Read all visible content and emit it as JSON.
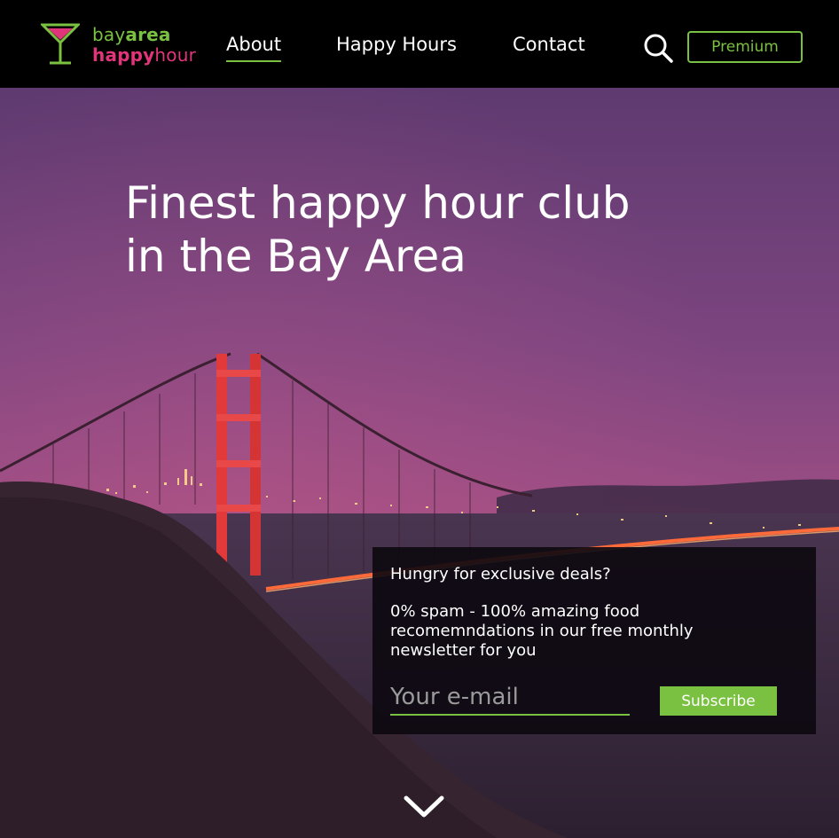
{
  "brand": {
    "line1_light": "bay",
    "line1_bold": "area",
    "line2_bold": "happy",
    "line2_light": "hour",
    "green": "#7ac142",
    "pink": "#e0357a"
  },
  "nav": {
    "about": "About",
    "happy_hours": "Happy Hours",
    "contact": "Contact",
    "premium": "Premium",
    "search_icon": "search-icon"
  },
  "hero": {
    "title_line1": "Finest happy hour club",
    "title_line2": "in the Bay Area"
  },
  "newsletter": {
    "heading": "Hungry for exclusive deals?",
    "text": "0% spam - 100% amazing food recomemndations in our free monthly newsletter for you",
    "email_placeholder": "Your e-mail",
    "email_value": "",
    "subscribe_label": "Subscribe"
  },
  "scroll_icon": "chevron-down-icon"
}
